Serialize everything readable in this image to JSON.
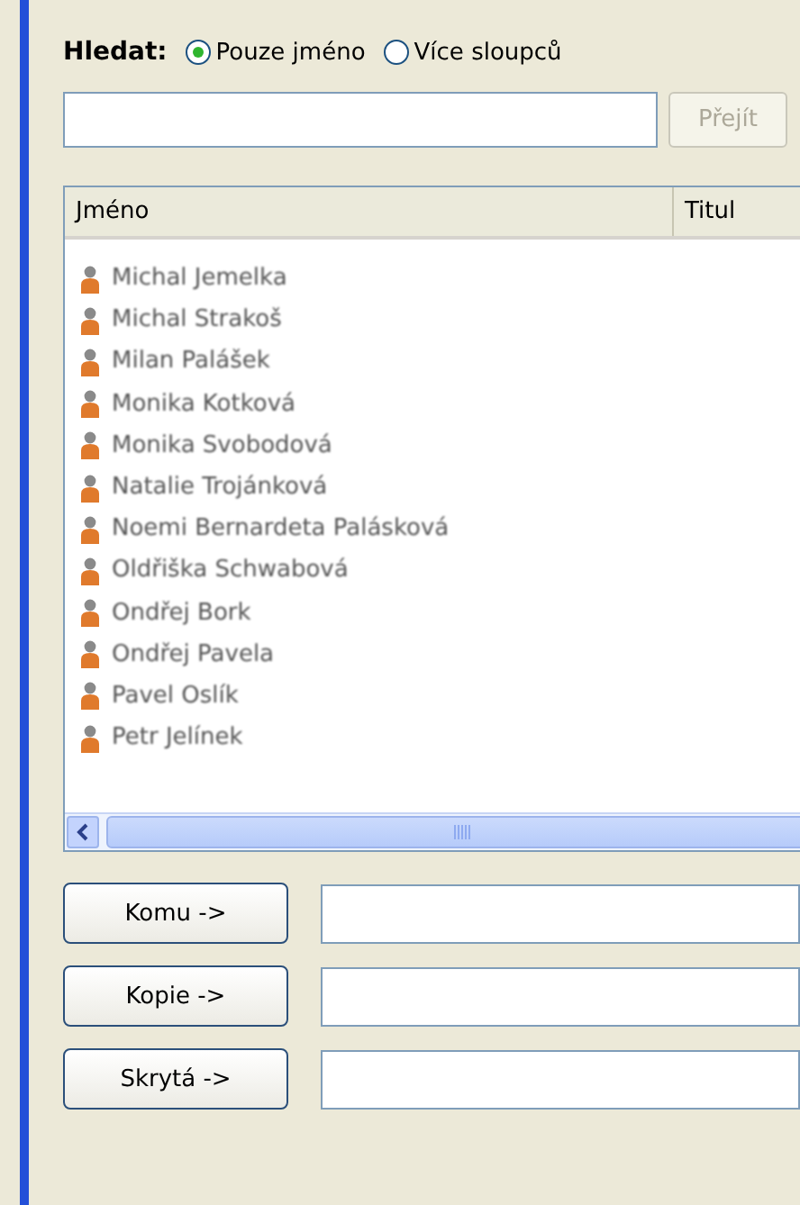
{
  "search": {
    "label": "Hledat:",
    "options": [
      {
        "label": "Pouze jméno",
        "selected": true
      },
      {
        "label": "Více sloupců",
        "selected": false
      }
    ],
    "go_button": {
      "label": "Přejít",
      "disabled": true
    }
  },
  "table": {
    "columns": [
      "Jméno",
      "Titul"
    ],
    "rows": [
      {
        "name": "Michal Jemelka"
      },
      {
        "name": "Michal Strakoš"
      },
      {
        "name": "Milan Palášek"
      },
      {
        "name": "Monika Kotková"
      },
      {
        "name": "Monika Svobodová"
      },
      {
        "name": "Natalie Trojánková"
      },
      {
        "name": "Noemi Bernardeta Palásková"
      },
      {
        "name": "Oldřiška Schwabová"
      },
      {
        "name": "Ondřej Bork"
      },
      {
        "name": "Ondřej Pavela"
      },
      {
        "name": "Pavel Oslík"
      },
      {
        "name": "Petr Jelínek"
      }
    ]
  },
  "recipients": [
    {
      "label": "Komu ->"
    },
    {
      "label": "Kopie ->"
    },
    {
      "label": "Skrytá ->"
    }
  ]
}
